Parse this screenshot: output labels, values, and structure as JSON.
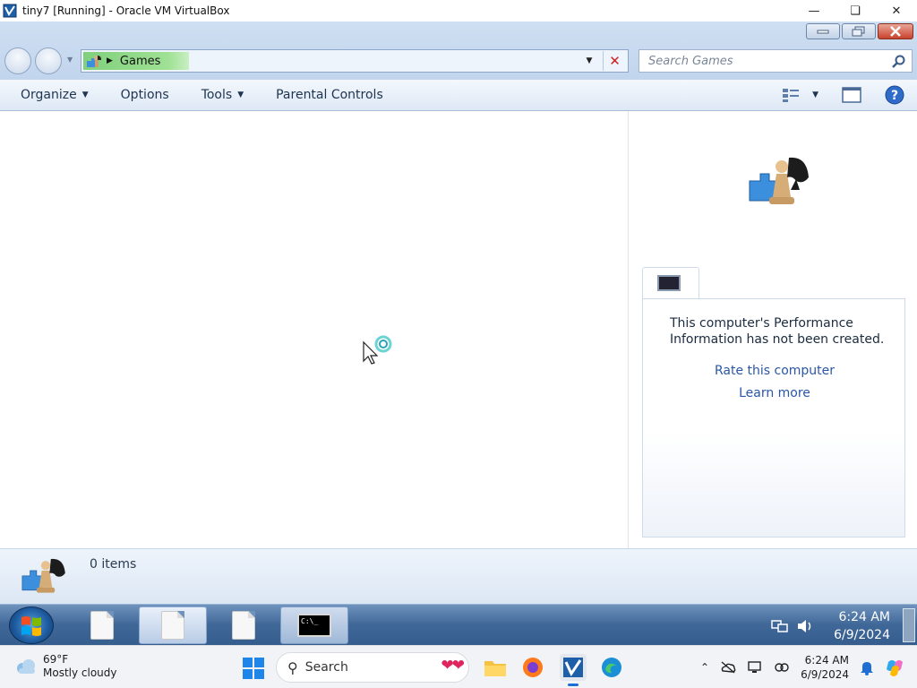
{
  "host_window": {
    "title": "tiny7 [Running] - Oracle VM VirtualBox",
    "controls": [
      "minimize",
      "maximize",
      "close"
    ]
  },
  "explorer": {
    "address": {
      "crumb": "Games",
      "clear_icon": "red-x-icon",
      "dropdown_icon": "chevron-down-icon"
    },
    "search": {
      "placeholder": "Search Games"
    },
    "toolbar": {
      "organize": "Organize",
      "options": "Options",
      "tools": "Tools",
      "parental_controls": "Parental Controls"
    },
    "preview": {
      "perf_message": "This computer's Performance Information has not been created.",
      "rate_link": "Rate this computer",
      "learn_link": "Learn more"
    },
    "details": {
      "item_count": "0 items"
    }
  },
  "vm_taskbar": {
    "time": "6:24 AM",
    "date": "6/9/2024",
    "cmd_text": "C:\\_"
  },
  "host_taskbar": {
    "weather_temp": "69°F",
    "weather_desc": "Mostly cloudy",
    "search_label": "Search",
    "time": "6:24 AM",
    "date": "6/9/2024"
  },
  "colors": {
    "win7_chrome": "#c6d8ee",
    "link_blue": "#2a56a6",
    "crumb_green": "#8fd98a",
    "vm_taskbar": "#3f6797",
    "host_accent": "#1e86e8"
  }
}
